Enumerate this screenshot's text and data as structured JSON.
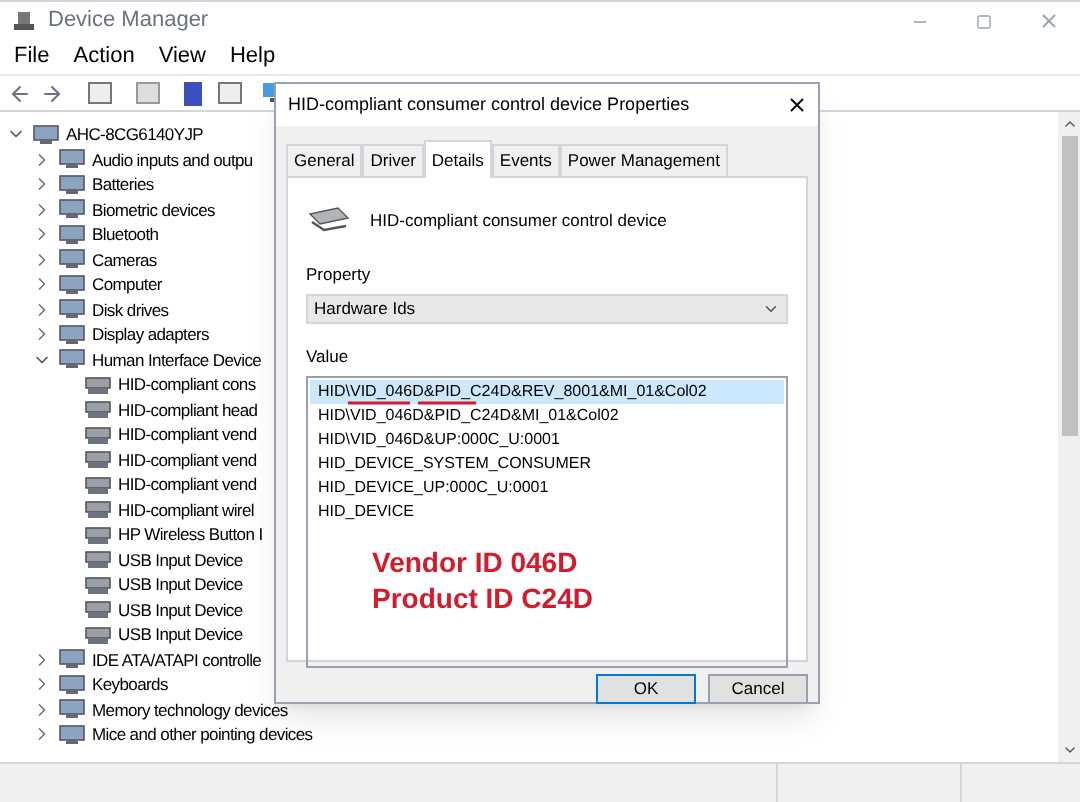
{
  "window": {
    "title": "Device Manager"
  },
  "menu": [
    "File",
    "Action",
    "View",
    "Help"
  ],
  "tree": {
    "label": "AHC-8CG6140YJP",
    "expanded": true,
    "children": [
      {
        "label": "Audio inputs and outpu",
        "expanded": false
      },
      {
        "label": "Batteries",
        "expanded": false
      },
      {
        "label": "Biometric devices",
        "expanded": false
      },
      {
        "label": "Bluetooth",
        "expanded": false
      },
      {
        "label": "Cameras",
        "expanded": false
      },
      {
        "label": "Computer",
        "expanded": false
      },
      {
        "label": "Disk drives",
        "expanded": false
      },
      {
        "label": "Display adapters",
        "expanded": false
      },
      {
        "label": "Human Interface Device",
        "expanded": true,
        "children": [
          {
            "label": "HID-compliant cons"
          },
          {
            "label": "HID-compliant head"
          },
          {
            "label": "HID-compliant vend"
          },
          {
            "label": "HID-compliant vend"
          },
          {
            "label": "HID-compliant vend"
          },
          {
            "label": "HID-compliant wirel"
          },
          {
            "label": "HP Wireless Button I"
          },
          {
            "label": "USB Input Device"
          },
          {
            "label": "USB Input Device"
          },
          {
            "label": "USB Input Device"
          },
          {
            "label": "USB Input Device"
          }
        ]
      },
      {
        "label": "IDE ATA/ATAPI controlle",
        "expanded": false
      },
      {
        "label": "Keyboards",
        "expanded": false
      },
      {
        "label": "Memory technology devices",
        "expanded": false
      },
      {
        "label": "Mice and other pointing devices",
        "expanded": false
      }
    ]
  },
  "dialog": {
    "title": "HID-compliant consumer control device Properties",
    "tabs": [
      {
        "label": "General",
        "selected": false
      },
      {
        "label": "Driver",
        "selected": false
      },
      {
        "label": "Details",
        "selected": true
      },
      {
        "label": "Events",
        "selected": false
      },
      {
        "label": "Power Management",
        "selected": false
      }
    ],
    "device_name": "HID-compliant consumer control device",
    "property_label": "Property",
    "property_value": "Hardware Ids",
    "value_label": "Value",
    "values": [
      {
        "text": "HID\\VID_046D&PID_C24D&REV_8001&MI_01&Col02",
        "selected": true
      },
      {
        "text": "HID\\VID_046D&PID_C24D&MI_01&Col02",
        "selected": false
      },
      {
        "text": "HID\\VID_046D&UP:000C_U:0001",
        "selected": false
      },
      {
        "text": "HID_DEVICE_SYSTEM_CONSUMER",
        "selected": false
      },
      {
        "text": "HID_DEVICE_UP:000C_U:0001",
        "selected": false
      },
      {
        "text": "HID_DEVICE",
        "selected": false
      }
    ],
    "annotation": [
      "Vendor ID 046D",
      "Product ID C24D"
    ],
    "buttons": [
      "OK",
      "Cancel"
    ]
  }
}
